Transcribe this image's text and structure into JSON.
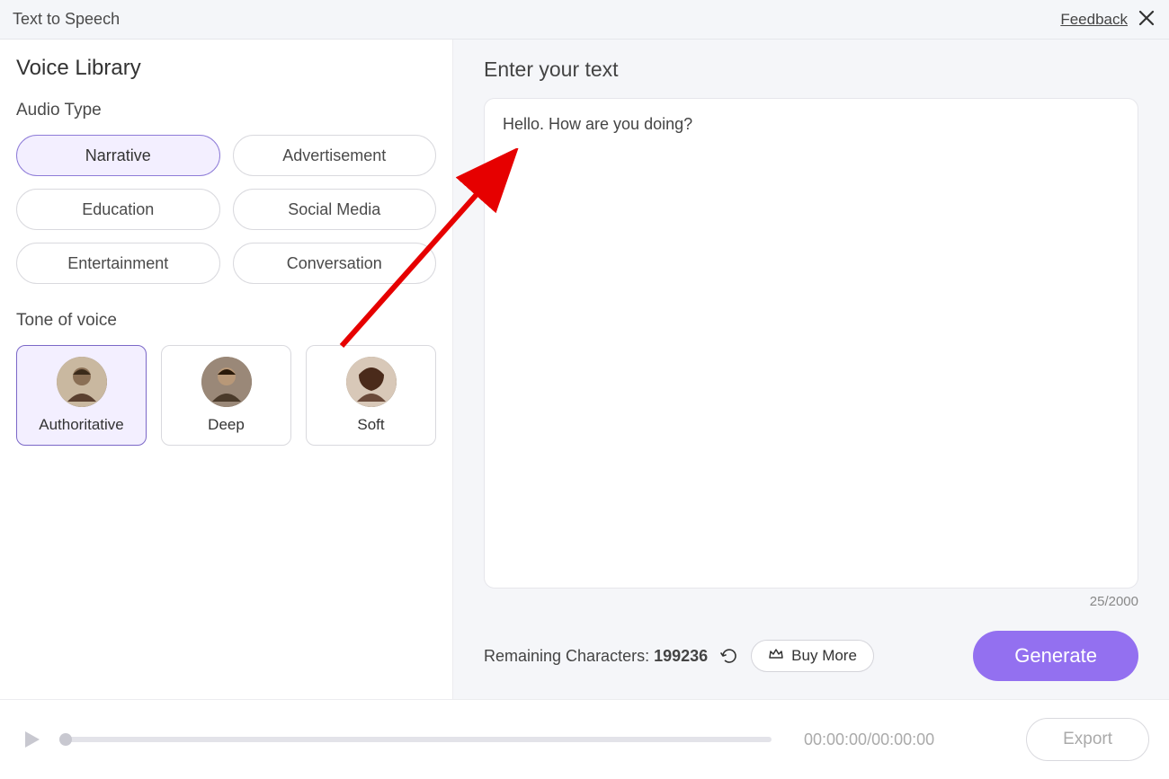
{
  "header": {
    "title": "Text to Speech",
    "feedback": "Feedback"
  },
  "sidebar": {
    "heading": "Voice Library",
    "audio_type_label": "Audio Type",
    "audio_types": [
      "Narrative",
      "Advertisement",
      "Education",
      "Social Media",
      "Entertainment",
      "Conversation"
    ],
    "audio_type_selected": 0,
    "tone_label": "Tone of voice",
    "tones": [
      {
        "label": "Authoritative"
      },
      {
        "label": "Deep"
      },
      {
        "label": "Soft"
      }
    ],
    "tone_selected": 0
  },
  "right": {
    "heading": "Enter your text",
    "text_value": "Hello. How are you doing?",
    "char_count": "25/2000",
    "remaining_label": "Remaining Characters: ",
    "remaining_value": "199236",
    "buy_more": "Buy More",
    "generate": "Generate"
  },
  "bottom": {
    "time": "00:00:00/00:00:00",
    "export": "Export"
  }
}
